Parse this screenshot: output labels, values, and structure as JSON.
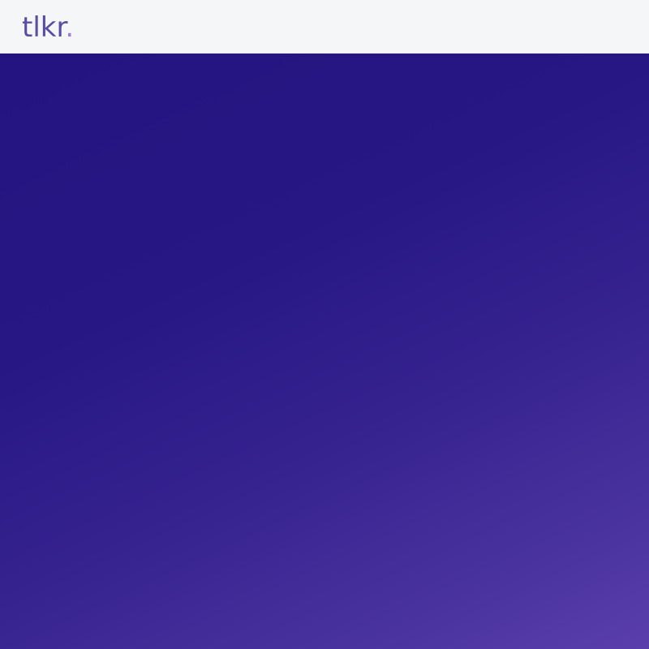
{
  "app": {
    "logo": {
      "text": "tlkr",
      "dot": "."
    }
  },
  "colors": {
    "topbar_bg": "#f4f6f7",
    "logo_text": "#5b4aa6",
    "logo_dot": "#a179e6",
    "hero_gradient_start": "#241481",
    "hero_gradient_end": "#5a3fac"
  }
}
